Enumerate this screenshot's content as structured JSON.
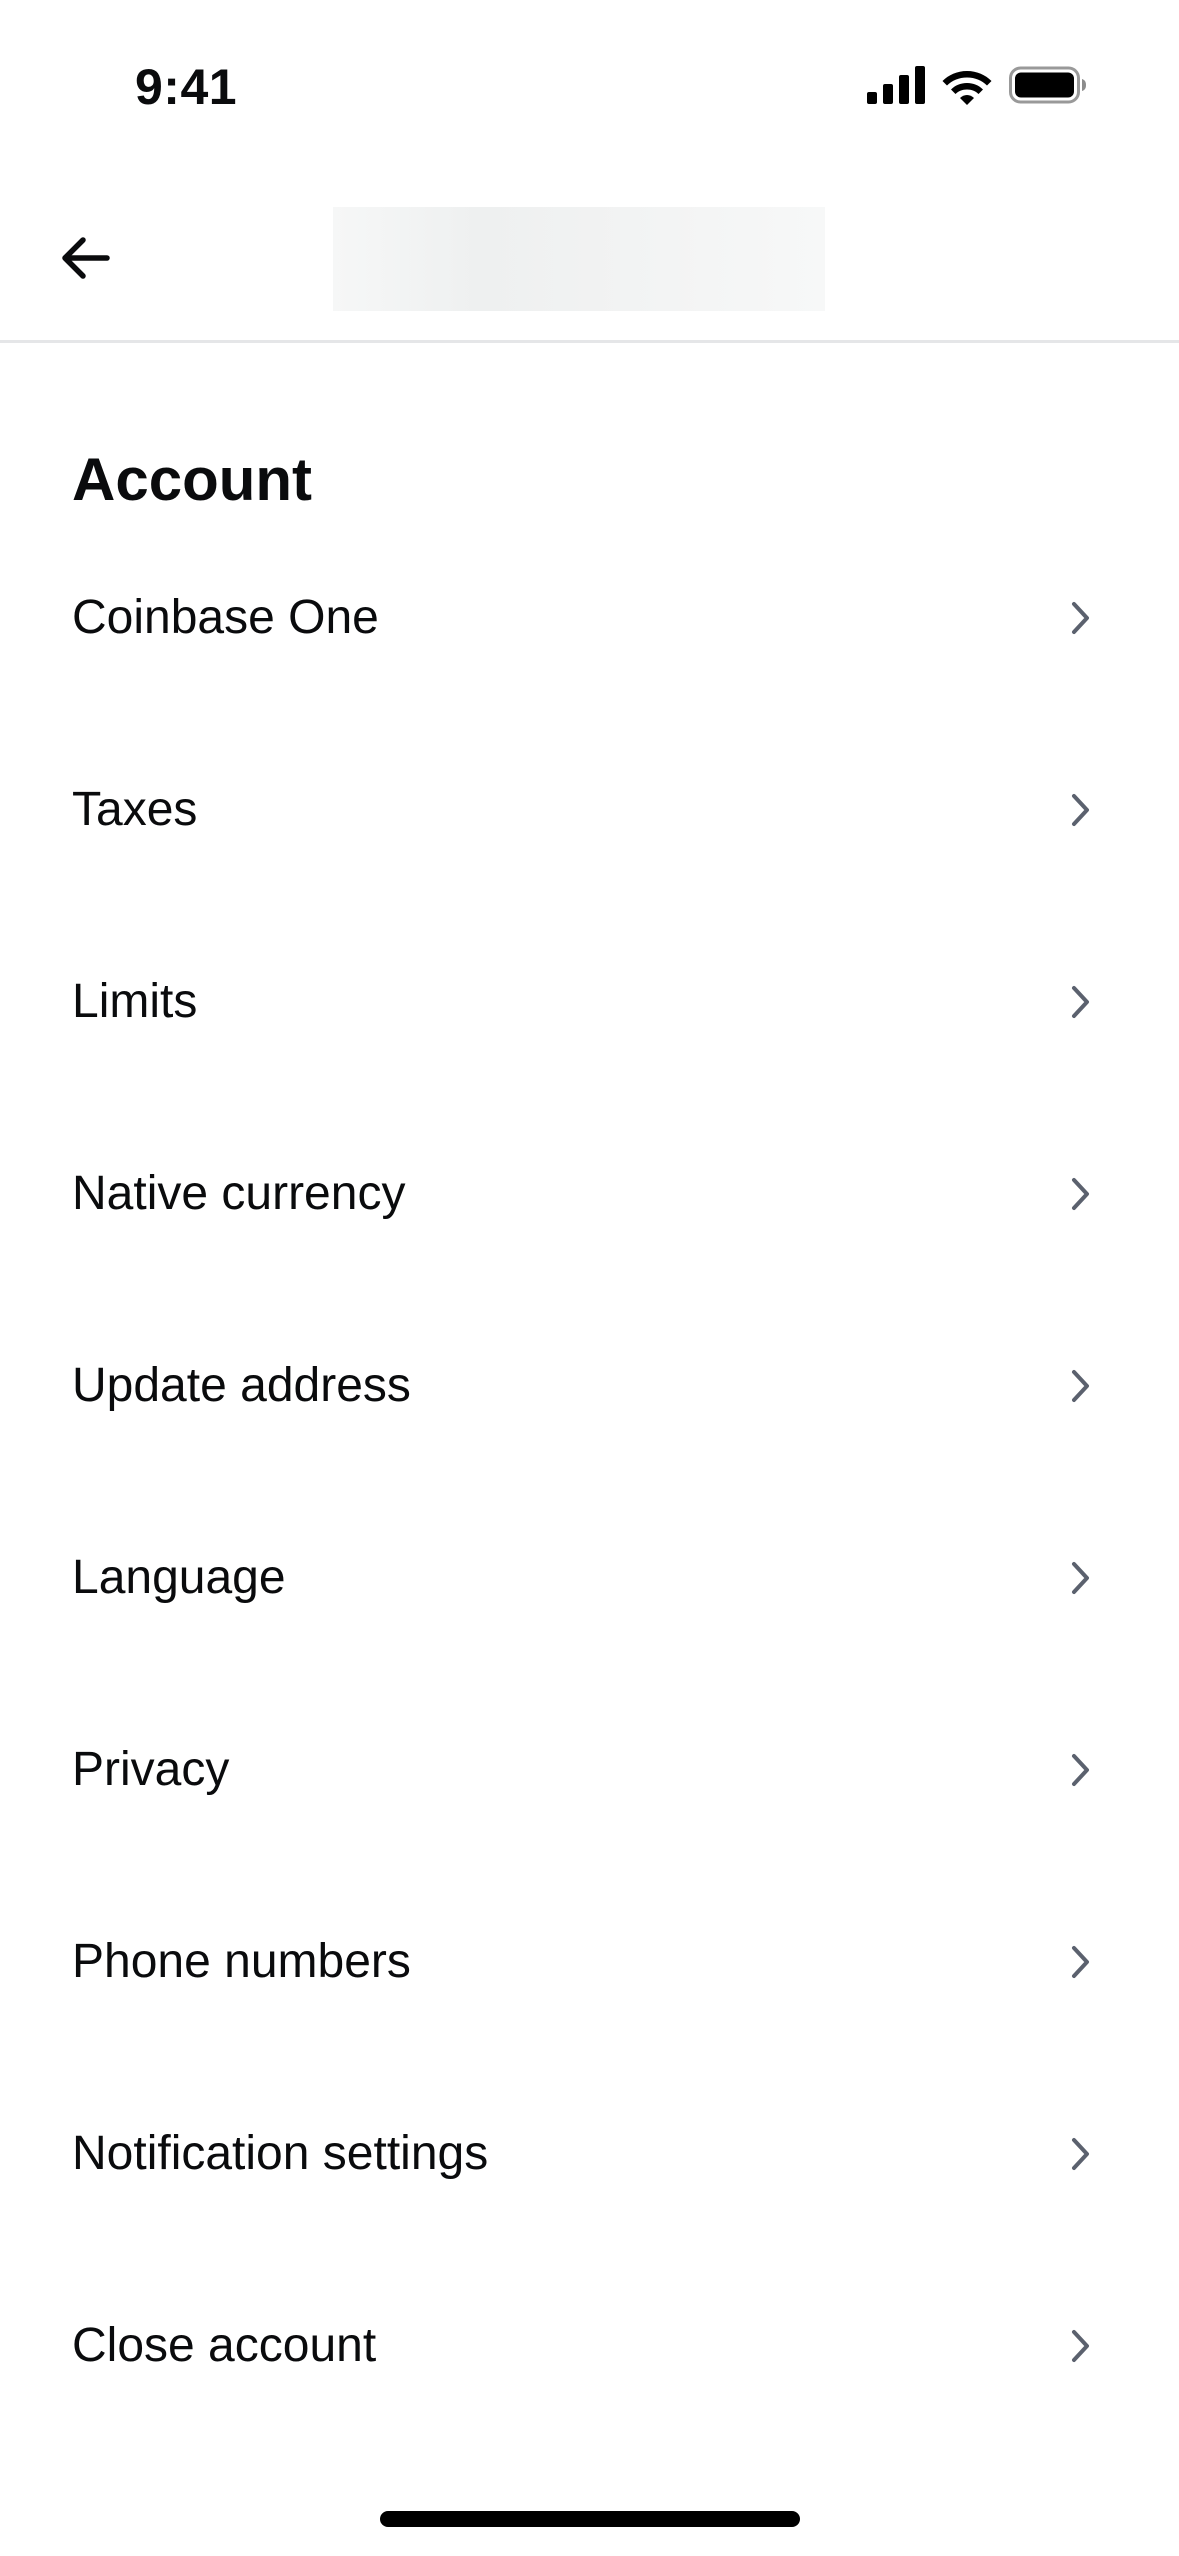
{
  "status_bar": {
    "time": "9:41",
    "icons": [
      "cellular-signal-icon",
      "wifi-icon",
      "battery-icon"
    ]
  },
  "nav": {
    "back_icon": "arrow-left-icon"
  },
  "section": {
    "title": "Account"
  },
  "menu": {
    "items": [
      {
        "label": "Coinbase One"
      },
      {
        "label": "Taxes"
      },
      {
        "label": "Limits"
      },
      {
        "label": "Native currency"
      },
      {
        "label": "Update address"
      },
      {
        "label": "Language"
      },
      {
        "label": "Privacy"
      },
      {
        "label": "Phone numbers"
      },
      {
        "label": "Notification settings"
      },
      {
        "label": "Close account"
      }
    ],
    "chevron_icon": "chevron-right-icon"
  },
  "colors": {
    "text": "#0a0b0d",
    "divider": "#e5e6e8",
    "chevron": "#5b616e",
    "background": "#ffffff"
  }
}
